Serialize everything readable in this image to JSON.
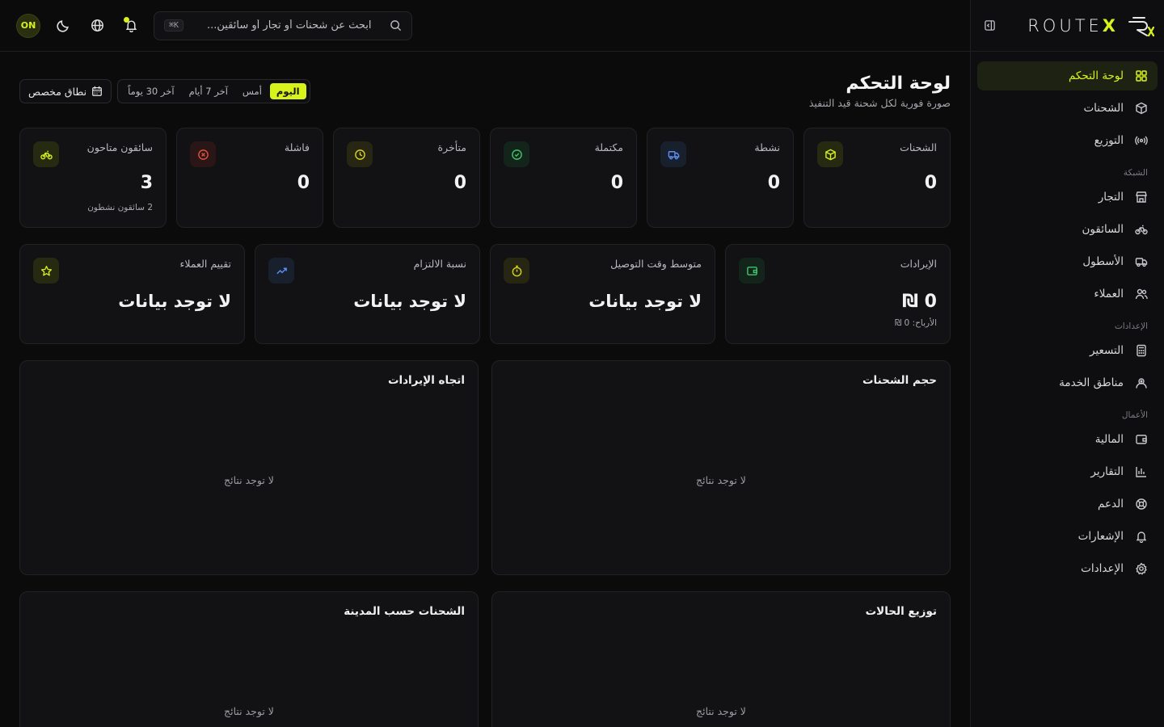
{
  "brand": {
    "name": "ROUTE",
    "accent_letter": "X"
  },
  "topbar": {
    "avatar": "ON",
    "search": {
      "placeholder": "ابحث عن شحنات أو تجار أو سائقين...",
      "shortcut": "⌘K"
    }
  },
  "sidebar": {
    "items_main": [
      {
        "label": "لوحة التحكم",
        "icon": "dashboard-icon",
        "active": true
      },
      {
        "label": "الشحنات",
        "icon": "box-icon"
      },
      {
        "label": "التوزيع",
        "icon": "radio-icon"
      }
    ],
    "group_network": "الشبكة",
    "items_network": [
      {
        "label": "التجار",
        "icon": "store-icon"
      },
      {
        "label": "السائقون",
        "icon": "bike-icon"
      },
      {
        "label": "الأسطول",
        "icon": "truck-icon"
      },
      {
        "label": "العملاء",
        "icon": "users-icon"
      }
    ],
    "group_settings": "الإعدادات",
    "items_settings": [
      {
        "label": "التسعير",
        "icon": "calculator-icon"
      },
      {
        "label": "مناطق الخدمة",
        "icon": "map-user-icon"
      }
    ],
    "group_business": "الأعمال",
    "items_business": [
      {
        "label": "المالية",
        "icon": "wallet-icon"
      },
      {
        "label": "التقارير",
        "icon": "chart-icon"
      },
      {
        "label": "الدعم",
        "icon": "lifebuoy-icon"
      },
      {
        "label": "الإشعارات",
        "icon": "bell-icon"
      },
      {
        "label": "الإعدادات",
        "icon": "gear-icon"
      }
    ]
  },
  "header": {
    "title": "لوحة التحكم",
    "subtitle": "صورة فورية لكل شحنة قيد التنفيذ",
    "custom_range": "نطاق مخصص",
    "ranges": [
      "اليوم",
      "أمس",
      "آخر 7 أيام",
      "آخر 30 يوماً"
    ]
  },
  "stats": [
    {
      "label": "الشحنات",
      "value": "0",
      "icon": "box-icon"
    },
    {
      "label": "نشطة",
      "value": "0",
      "icon": "truck-icon"
    },
    {
      "label": "مكتملة",
      "value": "0",
      "icon": "check-circle-icon"
    },
    {
      "label": "متأخرة",
      "value": "0",
      "icon": "clock-icon"
    },
    {
      "label": "فاشلة",
      "value": "0",
      "icon": "x-circle-icon"
    },
    {
      "label": "سائقون متاحون",
      "value": "3",
      "sub": "2 سائقون نشطون",
      "icon": "bike-icon"
    }
  ],
  "stats2": [
    {
      "label": "الإيرادات",
      "value": "₪ 0",
      "sub": "الأرباح: 0 ₪",
      "icon": "wallet-icon"
    },
    {
      "label": "متوسط وقت التوصيل",
      "value": "لا توجد بيانات",
      "icon": "timer-icon"
    },
    {
      "label": "نسبة الالتزام",
      "value": "لا توجد بيانات",
      "icon": "trend-icon"
    },
    {
      "label": "تقييم العملاء",
      "value": "لا توجد بيانات",
      "icon": "star-icon"
    }
  ],
  "charts": [
    {
      "title": "حجم الشحنات",
      "empty": "لا توجد نتائج"
    },
    {
      "title": "اتجاه الإيرادات",
      "empty": "لا توجد نتائج"
    },
    {
      "title": "توزيع الحالات",
      "empty": "لا توجد نتائج"
    },
    {
      "title": "الشحنات حسب المدينة",
      "empty": "لا توجد نتائج"
    }
  ],
  "colors": {
    "accent": "#d8f31c",
    "bg": "#0b0b0c",
    "card": "#121215"
  }
}
